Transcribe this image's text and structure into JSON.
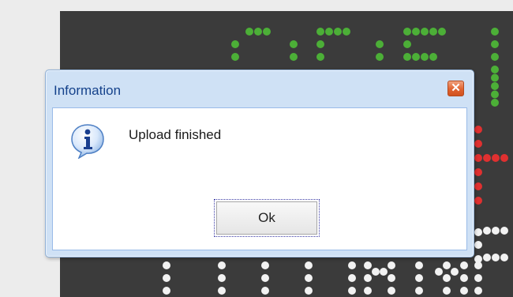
{
  "background_display": {
    "led_colors": {
      "green": "#4caf37",
      "red": "#e03030",
      "white": "#f2f2f2"
    }
  },
  "dialog": {
    "title": "Information",
    "close_icon": "close-icon",
    "message_icon": "info-icon",
    "message": "Upload finished",
    "ok_label": "Ok",
    "colors": {
      "title_text": "#15428b",
      "frame": "#cfe1f5",
      "close_button": "#e0622f"
    }
  }
}
